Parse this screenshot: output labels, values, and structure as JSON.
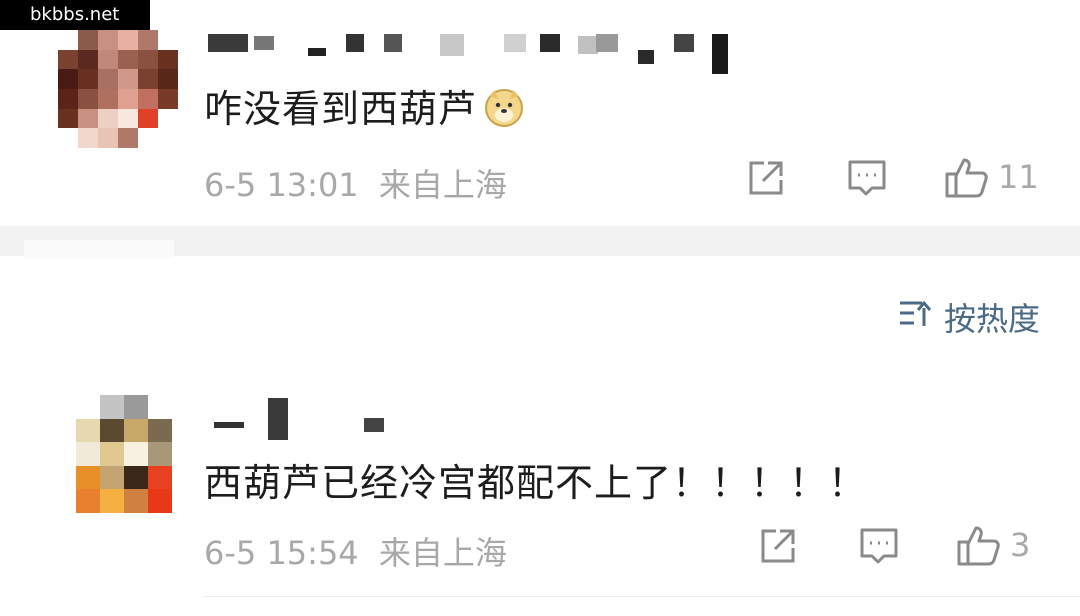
{
  "watermark": "bkbbs.net",
  "comments": [
    {
      "text": "咋没看到西葫芦",
      "emoji": "doge-emoji",
      "time": "6-5 13:01",
      "location": "来自上海",
      "likes": "11"
    },
    {
      "text": "西葫芦已经冷宫都配不上了！！！！！",
      "time": "6-5 15:54",
      "location": "来自上海",
      "likes": "3"
    }
  ],
  "sort": {
    "label": "按热度"
  },
  "colors": {
    "meta": "#a8a8a8",
    "sort": "#4a6a86",
    "text": "#1d1d1d"
  },
  "icons": [
    "share-icon",
    "reply-icon",
    "like-icon",
    "sort-icon"
  ]
}
